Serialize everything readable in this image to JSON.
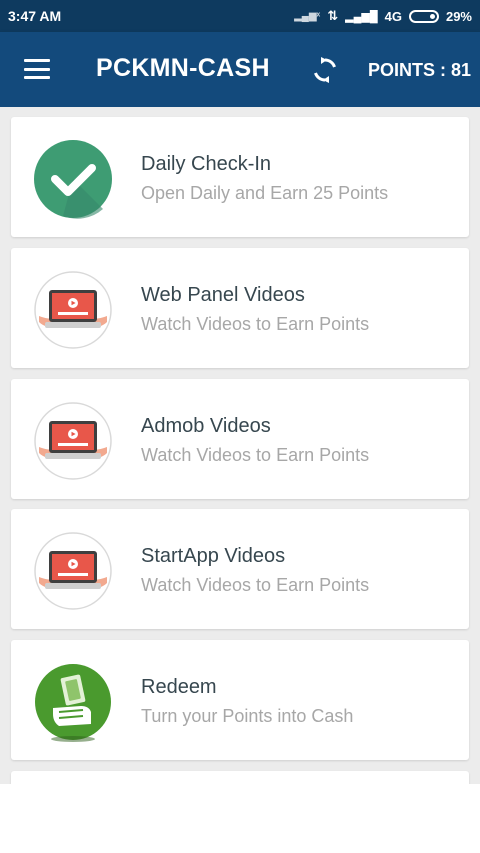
{
  "status_bar": {
    "time": "3:47 AM",
    "network": "4G",
    "battery": "29%"
  },
  "app_bar": {
    "title": "PCKMN-CASH",
    "points": "POINTS : 81"
  },
  "items": [
    {
      "title": "Daily Check-In",
      "subtitle": "Open Daily and Earn 25 Points",
      "icon": "checkmark-icon"
    },
    {
      "title": "Web Panel Videos",
      "subtitle": "Watch Videos to Earn Points",
      "icon": "video-laptop-icon"
    },
    {
      "title": "Admob Videos",
      "subtitle": "Watch Videos to Earn Points",
      "icon": "video-laptop-icon"
    },
    {
      "title": "StartApp Videos",
      "subtitle": "Watch Videos to Earn Points",
      "icon": "video-laptop-icon"
    },
    {
      "title": "Redeem",
      "subtitle": "Turn your Points into Cash",
      "icon": "cash-hand-icon"
    }
  ],
  "colors": {
    "status_bar": "#0e3a5f",
    "app_bar": "#134a7c",
    "check_green": "#3e9c73",
    "cash_green": "#4a9a2e",
    "video_red": "#e8574a"
  }
}
